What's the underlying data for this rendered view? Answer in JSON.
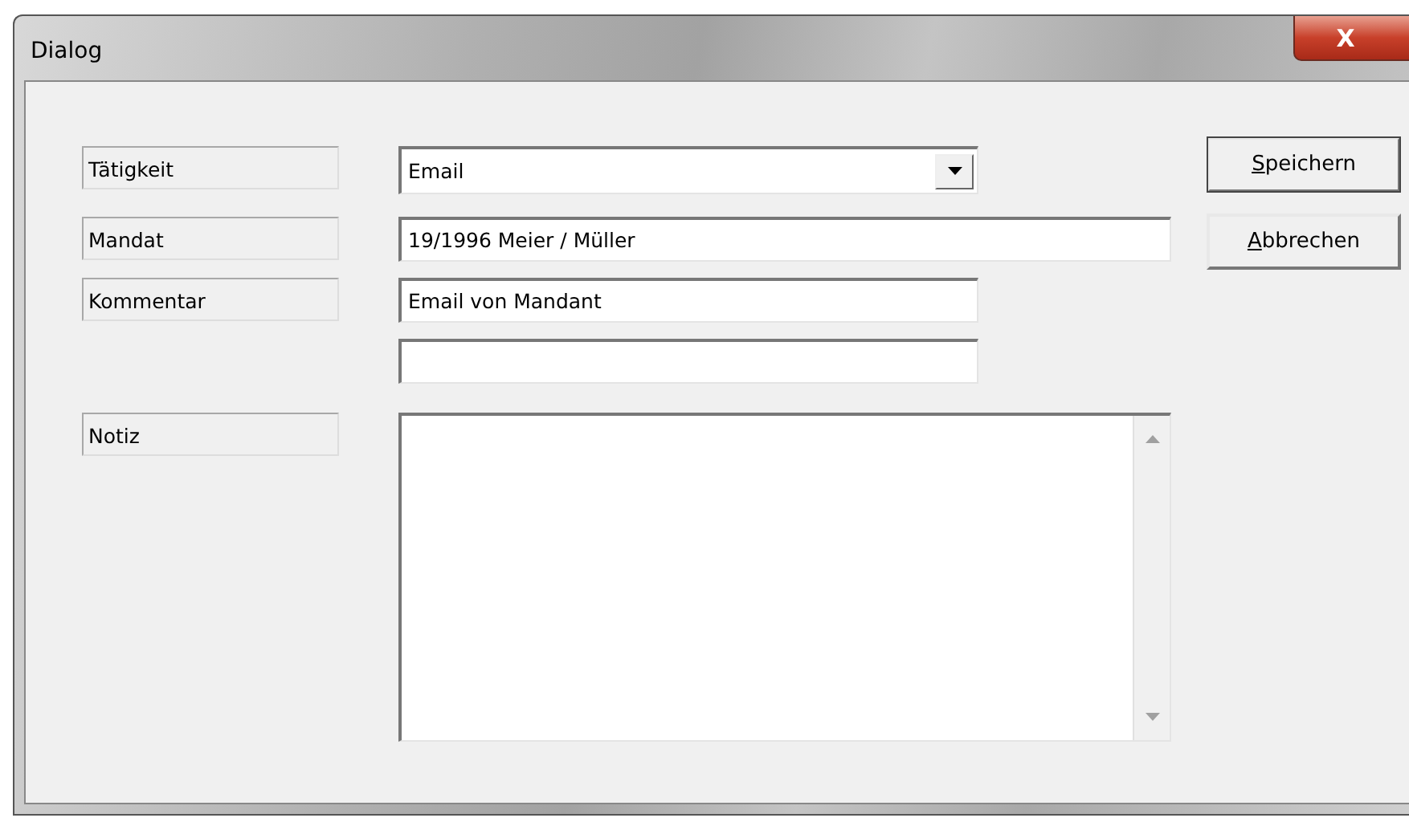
{
  "window": {
    "title": "Dialog",
    "close": "X"
  },
  "fields": [
    {
      "kind": "combo",
      "label": "Tätigkeit",
      "value": "Email"
    },
    {
      "kind": "text",
      "label": "Mandat",
      "value": "19/1996 Meier / Müller",
      "wide": true
    },
    {
      "kind": "text",
      "label": "Kommentar",
      "value": "Email von Mandant",
      "wide": false
    },
    {
      "kind": "text",
      "wide": false
    },
    {
      "kind": "memo",
      "label": "Notiz"
    }
  ],
  "buttons": [
    {
      "mnemonic": "S",
      "rest": "peichern",
      "default": true
    },
    {
      "mnemonic": "A",
      "rest": "bbrechen",
      "default": false
    }
  ]
}
